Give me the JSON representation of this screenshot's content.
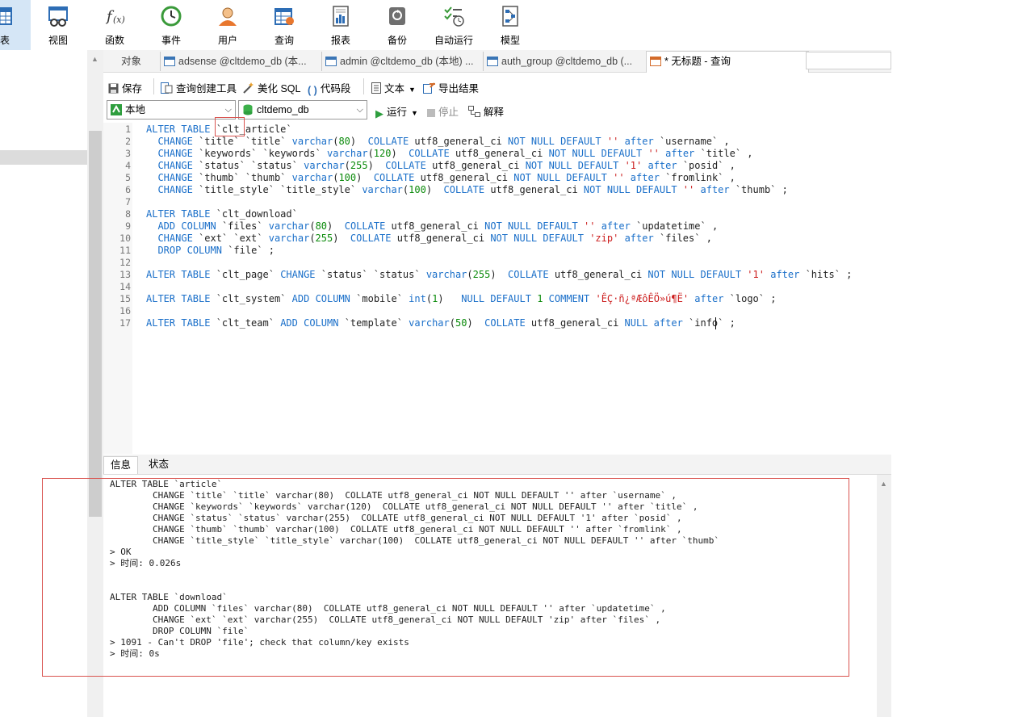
{
  "toolbar": {
    "items": [
      {
        "label": "表",
        "icon": "table-icon"
      },
      {
        "label": "视图",
        "icon": "view-icon"
      },
      {
        "label": "函数",
        "icon": "function-icon"
      },
      {
        "label": "事件",
        "icon": "event-clock-icon"
      },
      {
        "label": "用户",
        "icon": "user-icon"
      },
      {
        "label": "查询",
        "icon": "query-icon"
      },
      {
        "label": "报表",
        "icon": "report-icon"
      },
      {
        "label": "备份",
        "icon": "backup-icon"
      },
      {
        "label": "自动运行",
        "icon": "autorun-icon"
      },
      {
        "label": "模型",
        "icon": "model-icon"
      }
    ]
  },
  "tabs": {
    "objects": "对象",
    "tab1": "adsense @cltdemo_db (本...",
    "tab2": "admin @cltdemo_db (本地) ...",
    "tab3": "auth_group @cltdemo_db (...",
    "active": "* 无标题 - 查询"
  },
  "query_toolbar": {
    "save": "保存",
    "query_builder": "查询创建工具",
    "beautify_sql": "美化 SQL",
    "code_snippet": "代码段",
    "text": "文本",
    "export": "导出结果"
  },
  "selectors": {
    "connection": "本地",
    "database": "cltdemo_db",
    "run": "运行",
    "stop": "停止",
    "explain": "解释"
  },
  "editor": {
    "line_numbers": [
      "1",
      "2",
      "3",
      "4",
      "5",
      "6",
      "7",
      "8",
      "9",
      "10",
      "11",
      "12",
      "13",
      "14",
      "15",
      "16",
      "17"
    ],
    "lines": [
      "ALTER TABLE `clt_article`",
      "  CHANGE `title` `title` varchar(80)  COLLATE utf8_general_ci NOT NULL DEFAULT '' after `username` ,",
      "  CHANGE `keywords` `keywords` varchar(120)  COLLATE utf8_general_ci NOT NULL DEFAULT '' after `title` ,",
      "  CHANGE `status` `status` varchar(255)  COLLATE utf8_general_ci NOT NULL DEFAULT '1' after `posid` ,",
      "  CHANGE `thumb` `thumb` varchar(100)  COLLATE utf8_general_ci NOT NULL DEFAULT '' after `fromlink` ,",
      "  CHANGE `title_style` `title_style` varchar(100)  COLLATE utf8_general_ci NOT NULL DEFAULT '' after `thumb` ;",
      "",
      "ALTER TABLE `clt_download`",
      "  ADD COLUMN `files` varchar(80)  COLLATE utf8_general_ci NOT NULL DEFAULT '' after `updatetime` ,",
      "  CHANGE `ext` `ext` varchar(255)  COLLATE utf8_general_ci NOT NULL DEFAULT 'zip' after `files` ,",
      "  DROP COLUMN `file` ;",
      "",
      "ALTER TABLE `clt_page` CHANGE `status` `status` varchar(255)  COLLATE utf8_general_ci NOT NULL DEFAULT '1' after `hits` ;",
      "",
      "ALTER TABLE `clt_system` ADD COLUMN `mobile` int(1)   NULL DEFAULT 1 COMMENT 'ÊÇ·ñ¿ªÆôÊÖ»ú¶Ë' after `logo` ;",
      "",
      "ALTER TABLE `clt_team` ADD COLUMN `template` varchar(50)  COLLATE utf8_general_ci NULL after `info` ;"
    ]
  },
  "result_tabs": {
    "info": "信息",
    "status": "状态"
  },
  "output": {
    "lines": [
      "ALTER TABLE `article`",
      "        CHANGE `title` `title` varchar(80)  COLLATE utf8_general_ci NOT NULL DEFAULT '' after `username` ,",
      "        CHANGE `keywords` `keywords` varchar(120)  COLLATE utf8_general_ci NOT NULL DEFAULT '' after `title` ,",
      "        CHANGE `status` `status` varchar(255)  COLLATE utf8_general_ci NOT NULL DEFAULT '1' after `posid` ,",
      "        CHANGE `thumb` `thumb` varchar(100)  COLLATE utf8_general_ci NOT NULL DEFAULT '' after `fromlink` ,",
      "        CHANGE `title_style` `title_style` varchar(100)  COLLATE utf8_general_ci NOT NULL DEFAULT '' after `thumb`",
      "> OK",
      "> 时间: 0.026s",
      "",
      "",
      "ALTER TABLE `download`",
      "        ADD COLUMN `files` varchar(80)  COLLATE utf8_general_ci NOT NULL DEFAULT '' after `updatetime` ,",
      "        CHANGE `ext` `ext` varchar(255)  COLLATE utf8_general_ci NOT NULL DEFAULT 'zip' after `files` ,",
      "        DROP COLUMN `file`",
      "> 1091 - Can't DROP 'file'; check that column/key exists",
      "> 时间: 0s"
    ]
  },
  "colors": {
    "keyword": "#1a6fc9",
    "number": "#0a8a0a",
    "string": "#cc1d1d",
    "highlight_box": "#d9534f"
  }
}
